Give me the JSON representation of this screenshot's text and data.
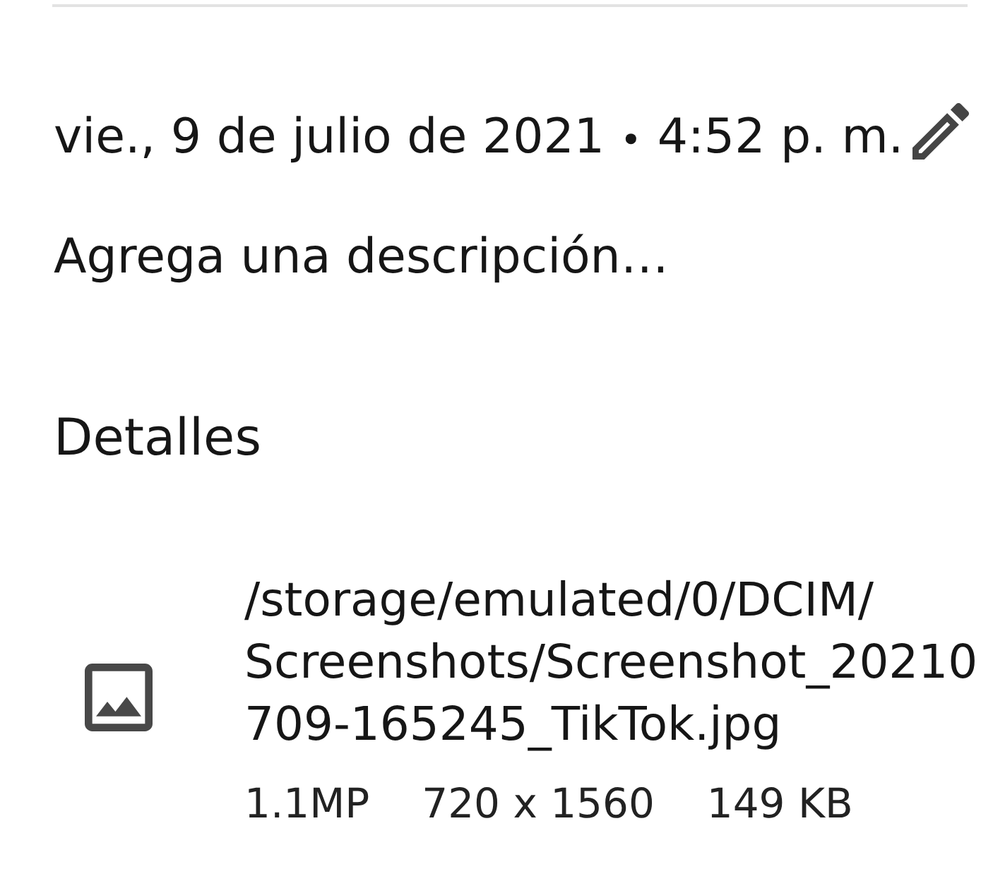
{
  "photo_info": {
    "date": "vie., 9 de julio de 2021",
    "separator": "•",
    "time": "4:52 p. m."
  },
  "description_field": {
    "placeholder": "Agrega una descripción…"
  },
  "details": {
    "heading": "Detalles",
    "items": [
      {
        "kind": "image",
        "path_lines": [
          "/storage/emulated/0/DCIM/",
          "Screenshots/Screenshot_20210",
          "709-165245_TikTok.jpg"
        ],
        "meta": [
          "1.1MP",
          "720 x 1560",
          "149 KB"
        ]
      }
    ]
  }
}
